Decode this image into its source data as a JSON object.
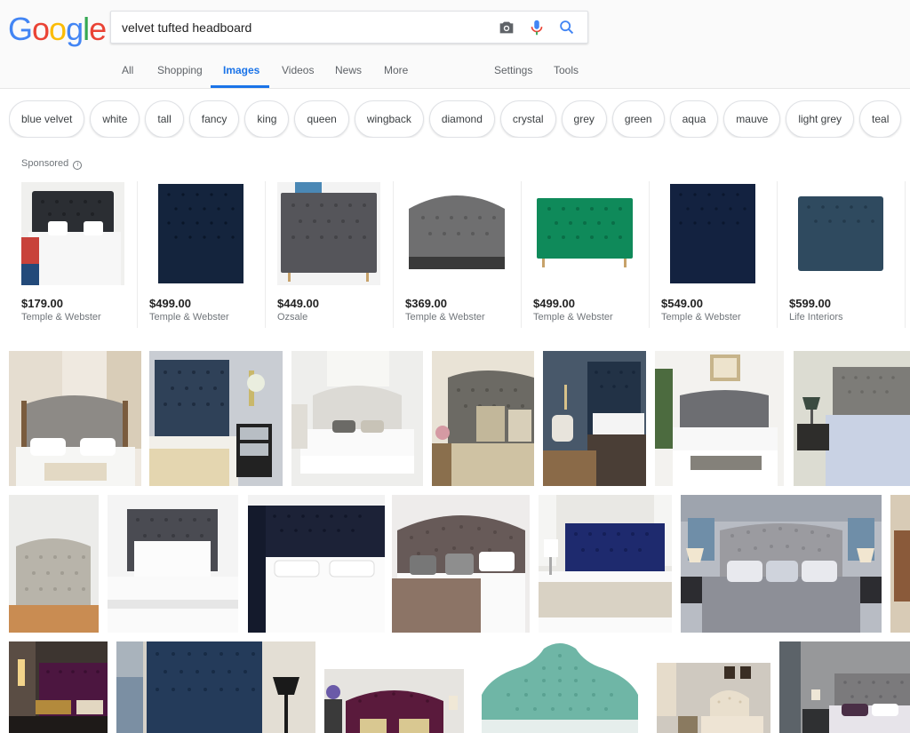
{
  "logo": {
    "letters": [
      "G",
      "o",
      "o",
      "g",
      "l",
      "e"
    ],
    "colors": [
      "#4285F4",
      "#EA4335",
      "#FBBC05",
      "#4285F4",
      "#34A853",
      "#EA4335"
    ]
  },
  "search": {
    "query": "velvet tufted headboard",
    "icons": [
      "camera-icon",
      "microphone-icon",
      "search-icon"
    ]
  },
  "tabs": {
    "all": "All",
    "shopping": "Shopping",
    "images": "Images",
    "videos": "Videos",
    "news": "News",
    "more": "More",
    "settings": "Settings",
    "tools": "Tools"
  },
  "chips": [
    "blue velvet",
    "white",
    "tall",
    "fancy",
    "king",
    "queen",
    "wingback",
    "diamond",
    "crystal",
    "grey",
    "green",
    "aqua",
    "mauve",
    "light grey",
    "teal"
  ],
  "sponsored_label": "Sponsored",
  "products": [
    {
      "price": "$179.00",
      "store": "Temple & Webster",
      "color": "#2b2e33"
    },
    {
      "price": "$499.00",
      "store": "Temple & Webster",
      "color": "#14243d"
    },
    {
      "price": "$449.00",
      "store": "Ozsale",
      "color": "#55555a"
    },
    {
      "price": "$369.00",
      "store": "Temple & Webster",
      "color": "#6f6f70"
    },
    {
      "price": "$499.00",
      "store": "Temple & Webster",
      "color": "#0f8a5a"
    },
    {
      "price": "$549.00",
      "store": "Temple & Webster",
      "color": "#132240"
    },
    {
      "price": "$599.00",
      "store": "Life Interiors",
      "color": "#2f4a5f"
    }
  ],
  "colors": {
    "accent": "#1a73e8",
    "muted": "#70757a"
  }
}
